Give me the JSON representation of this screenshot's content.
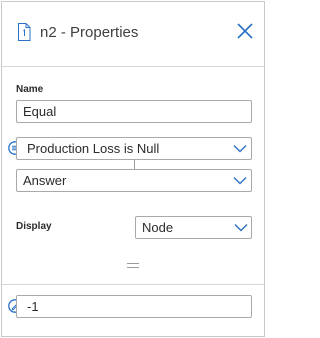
{
  "header": {
    "title": "n2 - Properties",
    "doc_icon": "document-icon",
    "close_icon": "close-icon"
  },
  "name_section": {
    "label": "Name",
    "value": "Equal"
  },
  "condition": {
    "icon": "condition-icon",
    "selected": "Production Loss is Null"
  },
  "answer": {
    "selected": "Answer"
  },
  "display": {
    "label": "Display",
    "selected": "Node"
  },
  "operator": {
    "symbol": "="
  },
  "value": {
    "icon": "edit-icon",
    "text": "-1"
  },
  "colors": {
    "accent": "#2a72c8",
    "border": "#a9a9a9",
    "text": "#2b2b2b"
  }
}
